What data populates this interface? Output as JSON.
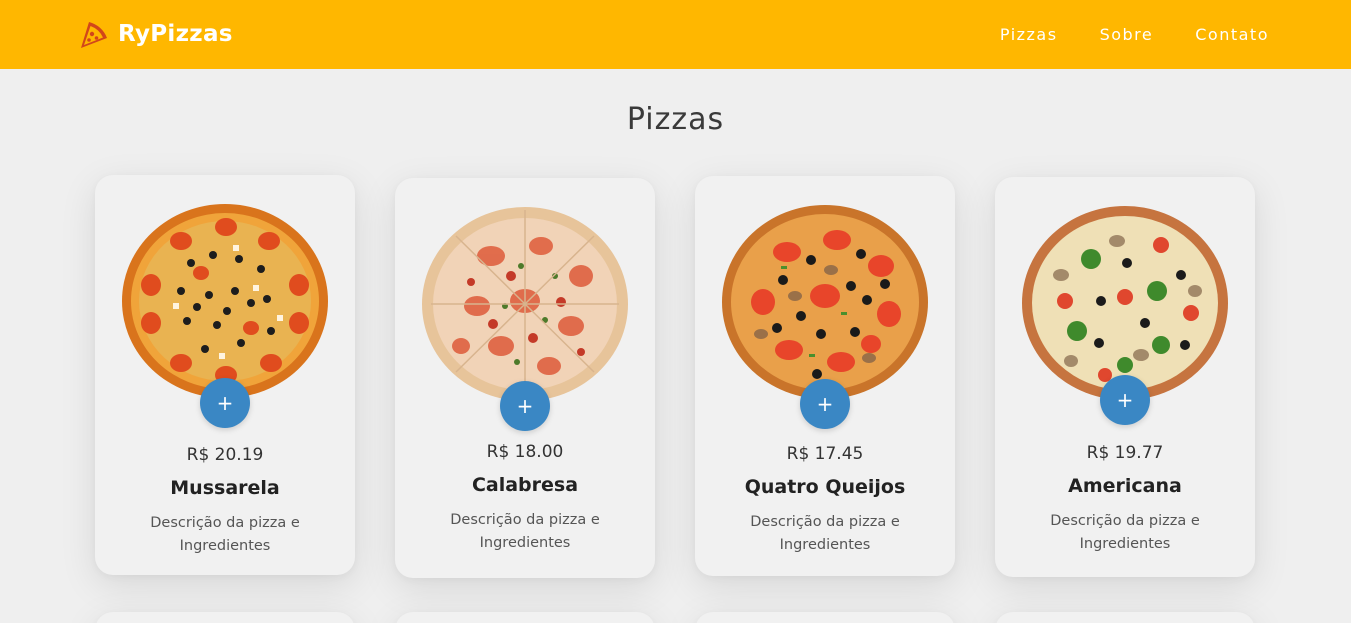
{
  "header": {
    "brand": "RyPizzas",
    "nav": [
      {
        "label": "Pizzas"
      },
      {
        "label": "Sobre"
      },
      {
        "label": "Contato"
      }
    ]
  },
  "main": {
    "title": "Pizzas",
    "add_label": "+",
    "cards": [
      {
        "price": "R$ 20.19",
        "name": "Mussarela",
        "description": "Descrição da pizza e Ingredientes"
      },
      {
        "price": "R$ 18.00",
        "name": "Calabresa",
        "description": "Descrição da pizza e Ingredientes"
      },
      {
        "price": "R$ 17.45",
        "name": "Quatro Queijos",
        "description": "Descrição da pizza e Ingredientes"
      },
      {
        "price": "R$ 19.77",
        "name": "Americana",
        "description": "Descrição da pizza e Ingredientes"
      }
    ]
  },
  "colors": {
    "header_bg": "#ffb700",
    "page_bg": "#efefef",
    "add_button": "#3a87c4"
  },
  "icons": {
    "logo": "pizza-slice-icon"
  }
}
